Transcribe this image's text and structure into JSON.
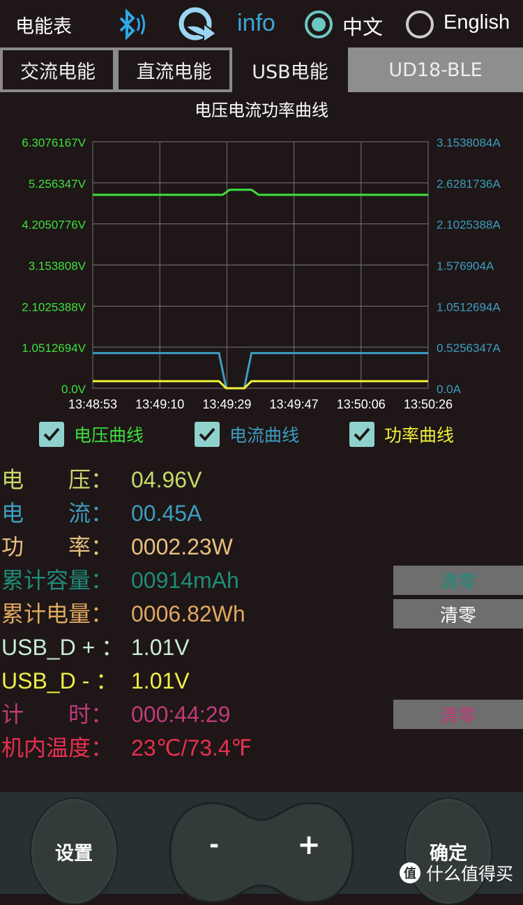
{
  "header": {
    "title": "电能表",
    "info_label": "info",
    "lang_options": [
      {
        "label": "中文",
        "selected": true
      },
      {
        "label": "English",
        "selected": false
      }
    ],
    "icons": [
      "bluetooth-icon",
      "sync-icon"
    ]
  },
  "tabs": [
    {
      "label": "交流电能",
      "active": false
    },
    {
      "label": "直流电能",
      "active": false
    },
    {
      "label": "USB电能",
      "active": true
    },
    {
      "label": "UD18-BLE",
      "active": false
    }
  ],
  "chart_data": {
    "type": "line",
    "title": "电压电流功率曲线",
    "left_ticks": [
      "0.0V",
      "1.0512694V",
      "2.1025388V",
      "3.153808V",
      "4.2050776V",
      "5.256347V",
      "6.3076167V"
    ],
    "right_ticks": [
      "0.0A",
      "0.5256347A",
      "1.0512694A",
      "1.576904A",
      "2.1025388A",
      "2.6281736A",
      "3.1538084A"
    ],
    "x_ticks": [
      "13:48:53",
      "13:49:10",
      "13:49:29",
      "13:49:47",
      "13:50:06",
      "13:50:26"
    ],
    "ylim_left": [
      0,
      6.3076167
    ],
    "ylim_right": [
      0,
      3.1538084
    ],
    "grid": true,
    "series": [
      {
        "name": "电压曲线",
        "unit": "V",
        "color": "#3ee03e",
        "points": [
          [
            "13:48:53",
            4.95
          ],
          [
            "13:49:29",
            4.95
          ],
          [
            "13:49:31",
            5.08
          ],
          [
            "13:49:37",
            5.08
          ],
          [
            "13:49:39",
            4.95
          ],
          [
            "13:50:26",
            4.95
          ]
        ]
      },
      {
        "name": "电流曲线",
        "unit": "A",
        "color": "#3c9ec0",
        "points": [
          [
            "13:48:53",
            0.45
          ],
          [
            "13:49:28",
            0.45
          ],
          [
            "13:49:30",
            0.0
          ],
          [
            "13:49:35",
            0.0
          ],
          [
            "13:49:37",
            0.45
          ],
          [
            "13:50:26",
            0.45
          ]
        ]
      },
      {
        "name": "功率曲线",
        "unit": "W",
        "color": "#f0f03a",
        "points": [
          [
            "13:48:53",
            2.23
          ],
          [
            "13:49:28",
            2.23
          ],
          [
            "13:49:30",
            0.0
          ],
          [
            "13:49:35",
            0.0
          ],
          [
            "13:49:37",
            2.23
          ],
          [
            "13:50:26",
            2.23
          ]
        ]
      }
    ]
  },
  "legend": [
    {
      "label": "电压曲线",
      "checked": true,
      "color": "#3ee03e"
    },
    {
      "label": "电流曲线",
      "checked": true,
      "color": "#3c9ec0"
    },
    {
      "label": "功率曲线",
      "checked": true,
      "color": "#f0f03a"
    }
  ],
  "readings": [
    {
      "label": "电　　压：",
      "value": "04.96V",
      "color": "#c8d86a"
    },
    {
      "label": "电　　流：",
      "value": "00.45A",
      "color": "#3c9ec0"
    },
    {
      "label": "功　　率：",
      "value": "0002.23W",
      "color": "#e8c080"
    },
    {
      "label": "累计容量：",
      "value": "00914mAh",
      "color": "#1e8c78",
      "clear": "清零"
    },
    {
      "label": "累计电量：",
      "value": "0006.82Wh",
      "color": "#e0a860",
      "clear": "清零",
      "clear_color": "#ffffff"
    },
    {
      "label": "USB_D + ：",
      "value": "1.01V",
      "color": "#c8ecd8"
    },
    {
      "label": "USB_D - ：",
      "value": "1.01V",
      "color": "#f0f048"
    },
    {
      "label": "计　　时：",
      "value": "000:44:29",
      "color": "#c03a78",
      "clear": "清零"
    },
    {
      "label": "机内温度：",
      "value": "23℃/73.4℉",
      "color": "#e83050"
    }
  ],
  "buttons": {
    "settings": "设置",
    "minus": "-",
    "plus": "+",
    "confirm": "确定"
  },
  "watermark": {
    "badge": "值",
    "text": "什么值得买"
  }
}
